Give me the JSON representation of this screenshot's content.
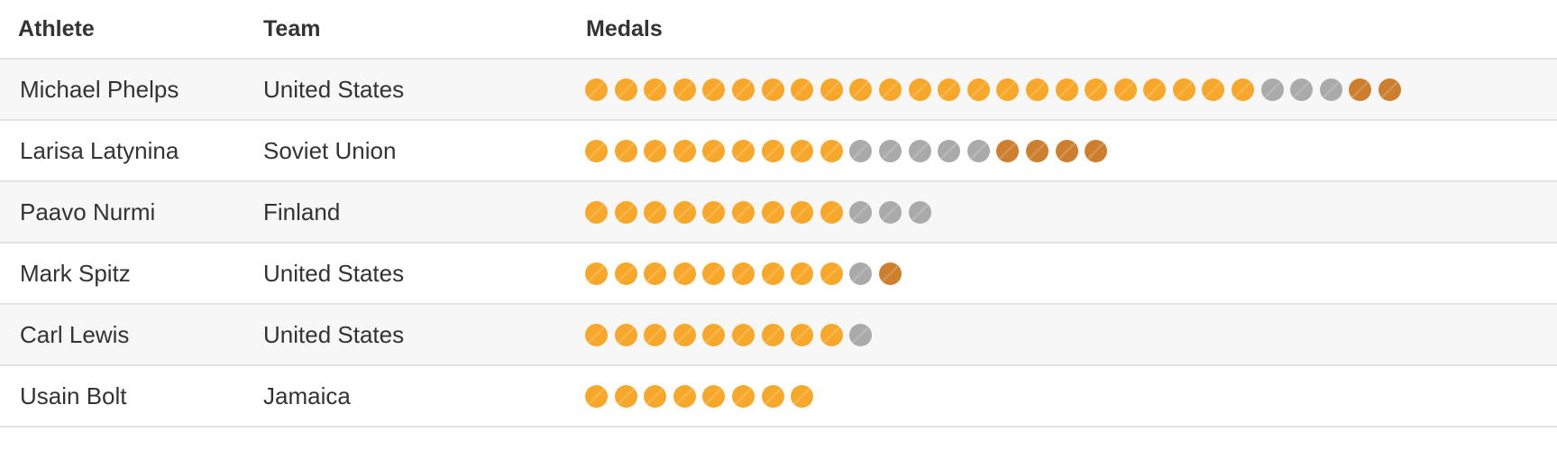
{
  "header": {
    "athlete": "Athlete",
    "team": "Team",
    "medals": "Medals"
  },
  "medal_colors": {
    "gold": "#f7a82a",
    "silver": "#aaaaaa",
    "bronze": "#cd7f2e"
  },
  "rows": [
    {
      "athlete": "Michael Phelps",
      "team": "United States",
      "gold": 23,
      "silver": 3,
      "bronze": 2
    },
    {
      "athlete": "Larisa Latynina",
      "team": "Soviet Union",
      "gold": 9,
      "silver": 5,
      "bronze": 4
    },
    {
      "athlete": "Paavo Nurmi",
      "team": "Finland",
      "gold": 9,
      "silver": 3,
      "bronze": 0
    },
    {
      "athlete": "Mark Spitz",
      "team": "United States",
      "gold": 9,
      "silver": 1,
      "bronze": 1
    },
    {
      "athlete": "Carl Lewis",
      "team": "United States",
      "gold": 9,
      "silver": 1,
      "bronze": 0
    },
    {
      "athlete": "Usain Bolt",
      "team": "Jamaica",
      "gold": 8,
      "silver": 0,
      "bronze": 0
    }
  ]
}
